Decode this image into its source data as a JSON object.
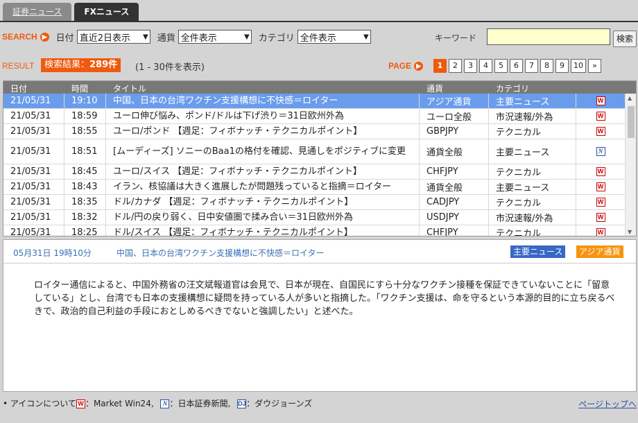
{
  "tabs": [
    {
      "label": "証券ニュース",
      "active": false
    },
    {
      "label": "FXニュース",
      "active": true
    }
  ],
  "search": {
    "label": "SEARCH",
    "date_label": "日付",
    "date_value": "直近2日表示",
    "currency_label": "通貨",
    "currency_value": "全件表示",
    "category_label": "カテゴリ",
    "category_value": "全件表示",
    "keyword_label": "キーワード",
    "keyword_value": "",
    "button_label": "検索"
  },
  "result": {
    "label": "RESULT",
    "badge_prefix": "検索結果：",
    "count": "289件",
    "range": "(1 - 30件を表示)",
    "page_label": "PAGE",
    "pages": [
      "1",
      "2",
      "3",
      "4",
      "5",
      "6",
      "7",
      "8",
      "9",
      "10",
      "»"
    ],
    "current_page": "1"
  },
  "table": {
    "headers": [
      "日付",
      "時間",
      "タイトル",
      "通貨",
      "カテゴリ"
    ],
    "rows": [
      {
        "date": "21/05/31",
        "time": "19:10",
        "title": "中国、日本の台湾ワクチン支援構想に不快感＝ロイター",
        "currency": "アジア通貨",
        "category": "主要ニュース",
        "icon": "W",
        "selected": true
      },
      {
        "date": "21/05/31",
        "time": "18:59",
        "title": "ユーロ伸び悩み、ポンド/ドルは下げ渋り＝31日欧州外為",
        "currency": "ユーロ全般",
        "category": "市況速報/外為",
        "icon": "W"
      },
      {
        "date": "21/05/31",
        "time": "18:55",
        "title": "ユーロ/ポンド 【週足：フィボナッチ・テクニカルポイント】",
        "currency": "GBPJPY",
        "category": "テクニカル",
        "icon": "W"
      },
      {
        "date": "21/05/31",
        "time": "18:51",
        "title": "[ムーディーズ] ソニーのBaa1の格付を確認、見通しをポジティブに変更",
        "currency": "通貨全般",
        "category": "主要ニュース",
        "icon": "N",
        "tall": true
      },
      {
        "date": "21/05/31",
        "time": "18:45",
        "title": "ユーロ/スイス 【週足：フィボナッチ・テクニカルポイント】",
        "currency": "CHFJPY",
        "category": "テクニカル",
        "icon": "W"
      },
      {
        "date": "21/05/31",
        "time": "18:43",
        "title": "イラン、核協議は大きく進展したが問題残っていると指摘＝ロイター",
        "currency": "通貨全般",
        "category": "主要ニュース",
        "icon": "W"
      },
      {
        "date": "21/05/31",
        "time": "18:35",
        "title": "ドル/カナダ 【週足：フィボナッチ・テクニカルポイント】",
        "currency": "CADJPY",
        "category": "テクニカル",
        "icon": "W"
      },
      {
        "date": "21/05/31",
        "time": "18:32",
        "title": "ドル/円の戻り弱く、日中安値圏で揉み合い＝31日欧州外為",
        "currency": "USDJPY",
        "category": "市況速報/外為",
        "icon": "W"
      },
      {
        "date": "21/05/31",
        "time": "18:25",
        "title": "ドル/スイス 【週足：フィボナッチ・テクニカルポイント】",
        "currency": "CHFJPY",
        "category": "テクニカル",
        "icon": "W"
      }
    ]
  },
  "detail": {
    "datetime": "05月31日 19時10分",
    "title": "中国、日本の台湾ワクチン支援構想に不快感＝ロイター",
    "tag_category": "主要ニュース",
    "tag_currency": "アジア通貨",
    "body": "ロイター通信によると、中国外務省の汪文斌報道官は会見で、日本が現在、自国民にすら十分なワクチン接種を保証できていないことに「留意している」とし、台湾でも日本の支援構想に疑問を持っている人が多いと指摘した。「ワクチン支援は、命を守るという本源的目的に立ち戻るべきで、政治的自己利益の手段におとしめるべきでないと強調したい」と述べた。"
  },
  "footer": {
    "bullet": "•",
    "legend_prefix": "アイコンについて",
    "legend_w": "：Market Win24,",
    "legend_n": "：日本証券新聞,",
    "legend_dj": "：ダウジョーンズ",
    "pagetop": "ページトップへ"
  },
  "colors": {
    "accent": "#ef5a0e",
    "selected_row": "#6a9cec",
    "tag_blue": "#3768c4",
    "tag_orange": "#f7930e",
    "keyword_bg": "#ffffcc"
  }
}
